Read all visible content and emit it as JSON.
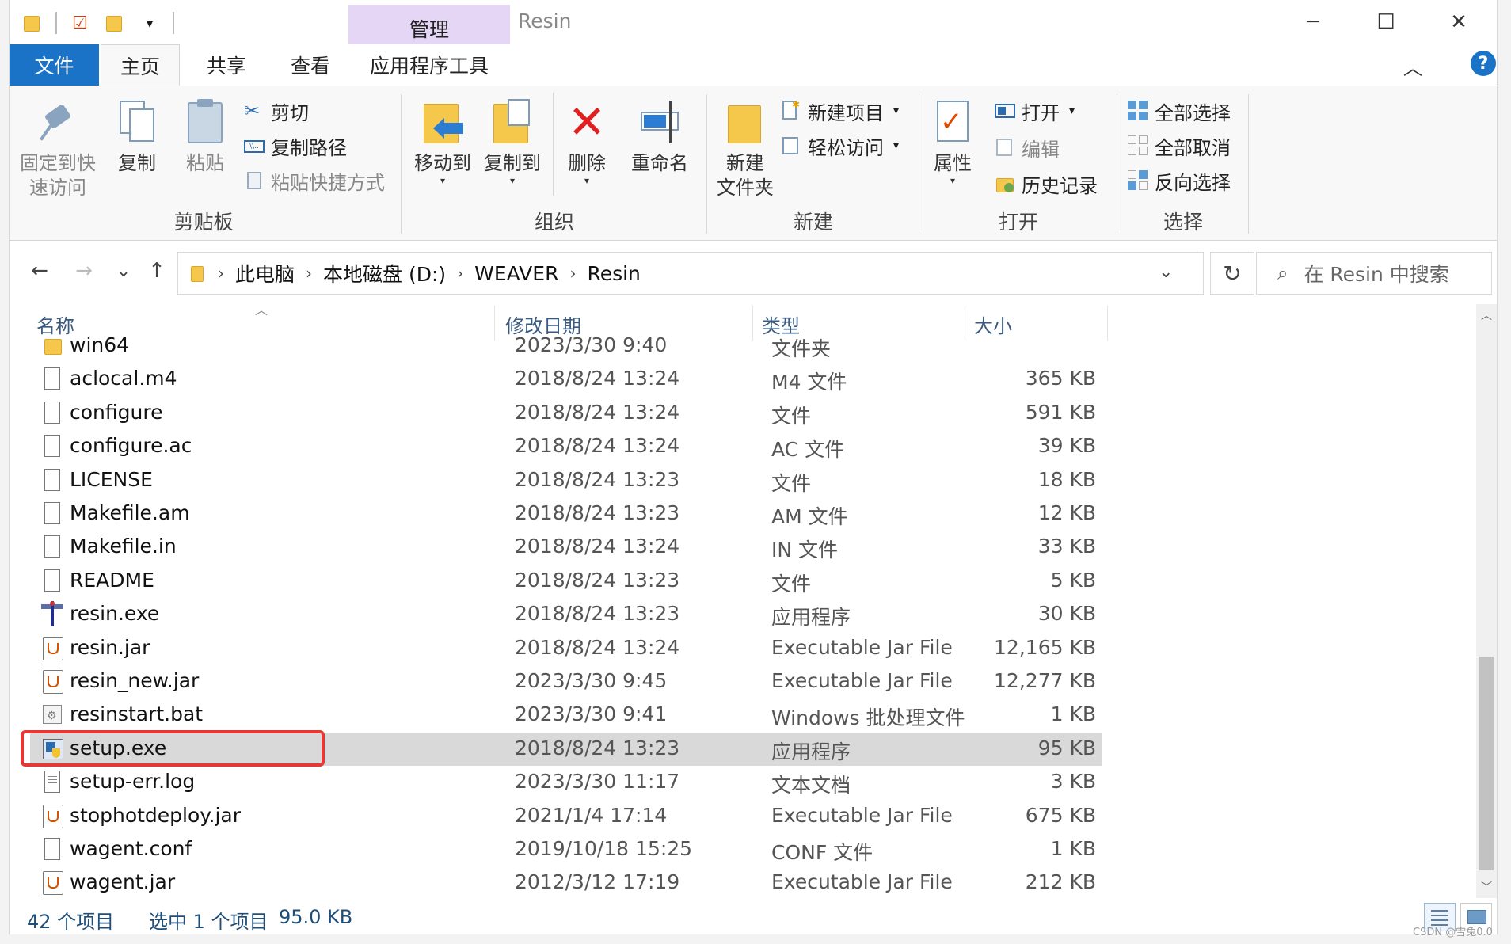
{
  "window": {
    "title": "Resin",
    "context_tab": "管理",
    "min_label": "─",
    "max_label": "☐",
    "close_label": "✕"
  },
  "tabs": {
    "file": "文件",
    "home": "主页",
    "share": "共享",
    "view": "查看",
    "app_tools": "应用程序工具"
  },
  "ribbon": {
    "clipboard": {
      "label": "剪贴板",
      "pin": "固定到快速访问",
      "pin_line1": "固定到快",
      "pin_line2": "速访问",
      "copy": "复制",
      "paste": "粘贴",
      "cut": "剪切",
      "copy_path": "复制路径",
      "paste_shortcut": "粘贴快捷方式"
    },
    "organize": {
      "label": "组织",
      "move_to": "移动到",
      "copy_to": "复制到",
      "delete": "删除",
      "rename": "重命名"
    },
    "new": {
      "label": "新建",
      "new_folder_line1": "新建",
      "new_folder_line2": "文件夹",
      "new_item": "新建项目",
      "easy_access": "轻松访问"
    },
    "open": {
      "label": "打开",
      "properties": "属性",
      "open": "打开",
      "edit": "编辑",
      "history": "历史记录"
    },
    "select": {
      "label": "选择",
      "select_all": "全部选择",
      "select_none": "全部取消",
      "invert": "反向选择"
    }
  },
  "nav": {
    "back": "←",
    "forward": "→",
    "recent": "⌄",
    "up": "↑",
    "breadcrumb": [
      "此电脑",
      "本地磁盘 (D:)",
      "WEAVER",
      "Resin"
    ],
    "refresh": "↻",
    "search_placeholder": "在 Resin 中搜索"
  },
  "columns": {
    "name": "名称",
    "date": "修改日期",
    "type": "类型",
    "size": "大小"
  },
  "files": [
    {
      "name": "win64",
      "date": "2023/3/30 9:40",
      "type": "文件夹",
      "size": "",
      "icon": "folder-icon"
    },
    {
      "name": "aclocal.m4",
      "date": "2018/8/24 13:24",
      "type": "M4 文件",
      "size": "365 KB",
      "icon": "file-icon"
    },
    {
      "name": "configure",
      "date": "2018/8/24 13:24",
      "type": "文件",
      "size": "591 KB",
      "icon": "file-icon"
    },
    {
      "name": "configure.ac",
      "date": "2018/8/24 13:24",
      "type": "AC 文件",
      "size": "39 KB",
      "icon": "file-icon"
    },
    {
      "name": "LICENSE",
      "date": "2018/8/24 13:23",
      "type": "文件",
      "size": "18 KB",
      "icon": "file-icon"
    },
    {
      "name": "Makefile.am",
      "date": "2018/8/24 13:23",
      "type": "AM 文件",
      "size": "12 KB",
      "icon": "file-icon"
    },
    {
      "name": "Makefile.in",
      "date": "2018/8/24 13:24",
      "type": "IN 文件",
      "size": "33 KB",
      "icon": "file-icon"
    },
    {
      "name": "README",
      "date": "2018/8/24 13:23",
      "type": "文件",
      "size": "5 KB",
      "icon": "file-icon"
    },
    {
      "name": "resin.exe",
      "date": "2018/8/24 13:23",
      "type": "应用程序",
      "size": "30 KB",
      "icon": "exe-icon"
    },
    {
      "name": "resin.jar",
      "date": "2018/8/24 13:24",
      "type": "Executable Jar File",
      "size": "12,165 KB",
      "icon": "jar-icon"
    },
    {
      "name": "resin_new.jar",
      "date": "2023/3/30 9:45",
      "type": "Executable Jar File",
      "size": "12,277 KB",
      "icon": "jar-icon"
    },
    {
      "name": "resinstart.bat",
      "date": "2023/3/30 9:41",
      "type": "Windows 批处理文件",
      "size": "1 KB",
      "icon": "bat-icon"
    },
    {
      "name": "setup.exe",
      "date": "2018/8/24 13:23",
      "type": "应用程序",
      "size": "95 KB",
      "icon": "setup-icon",
      "selected": true
    },
    {
      "name": "setup-err.log",
      "date": "2023/3/30 11:17",
      "type": "文本文档",
      "size": "3 KB",
      "icon": "text-file-icon"
    },
    {
      "name": "stophotdeploy.jar",
      "date": "2021/1/4 17:14",
      "type": "Executable Jar File",
      "size": "675 KB",
      "icon": "jar-icon"
    },
    {
      "name": "wagent.conf",
      "date": "2019/10/18 15:25",
      "type": "CONF 文件",
      "size": "1 KB",
      "icon": "file-icon"
    },
    {
      "name": "wagent.jar",
      "date": "2012/3/12 17:19",
      "type": "Executable Jar File",
      "size": "212 KB",
      "icon": "jar-icon"
    }
  ],
  "status": {
    "count": "42 个项目",
    "selected": "选中 1 个项目",
    "selected_size": "95.0 KB"
  },
  "watermark": "CSDN @雪兔0.0",
  "colors": {
    "accent": "#1a73c6",
    "context_tab": "#e6d6f5",
    "selection_row": "#d9d9d9",
    "highlight_box": "#e53935"
  }
}
